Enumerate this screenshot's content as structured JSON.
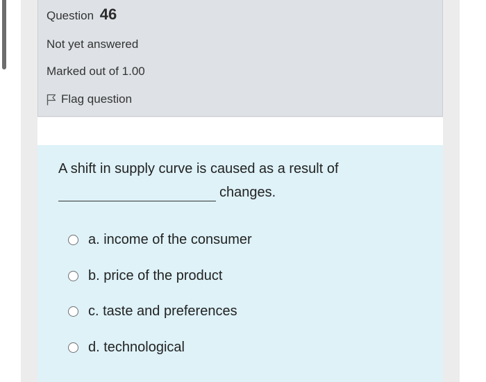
{
  "info": {
    "question_label": "Question",
    "question_number": "46",
    "state": "Not yet answered",
    "grade": "Marked out of 1.00",
    "flag_label": "Flag question",
    "flag_icon": "flag-outline-icon"
  },
  "question": {
    "text_line1": "A shift in supply curve is caused as a result of",
    "text_line2": "changes."
  },
  "options": [
    {
      "label": "a. income of the consumer",
      "selected": false
    },
    {
      "label": "b. price of the product",
      "selected": false
    },
    {
      "label": "c. taste and preferences",
      "selected": false
    },
    {
      "label": "d. technological",
      "selected": false
    }
  ],
  "colors": {
    "info_panel_bg": "#dee2e6",
    "content_panel_bg": "#def2f8",
    "outer_frame_bg": "#ececec"
  }
}
